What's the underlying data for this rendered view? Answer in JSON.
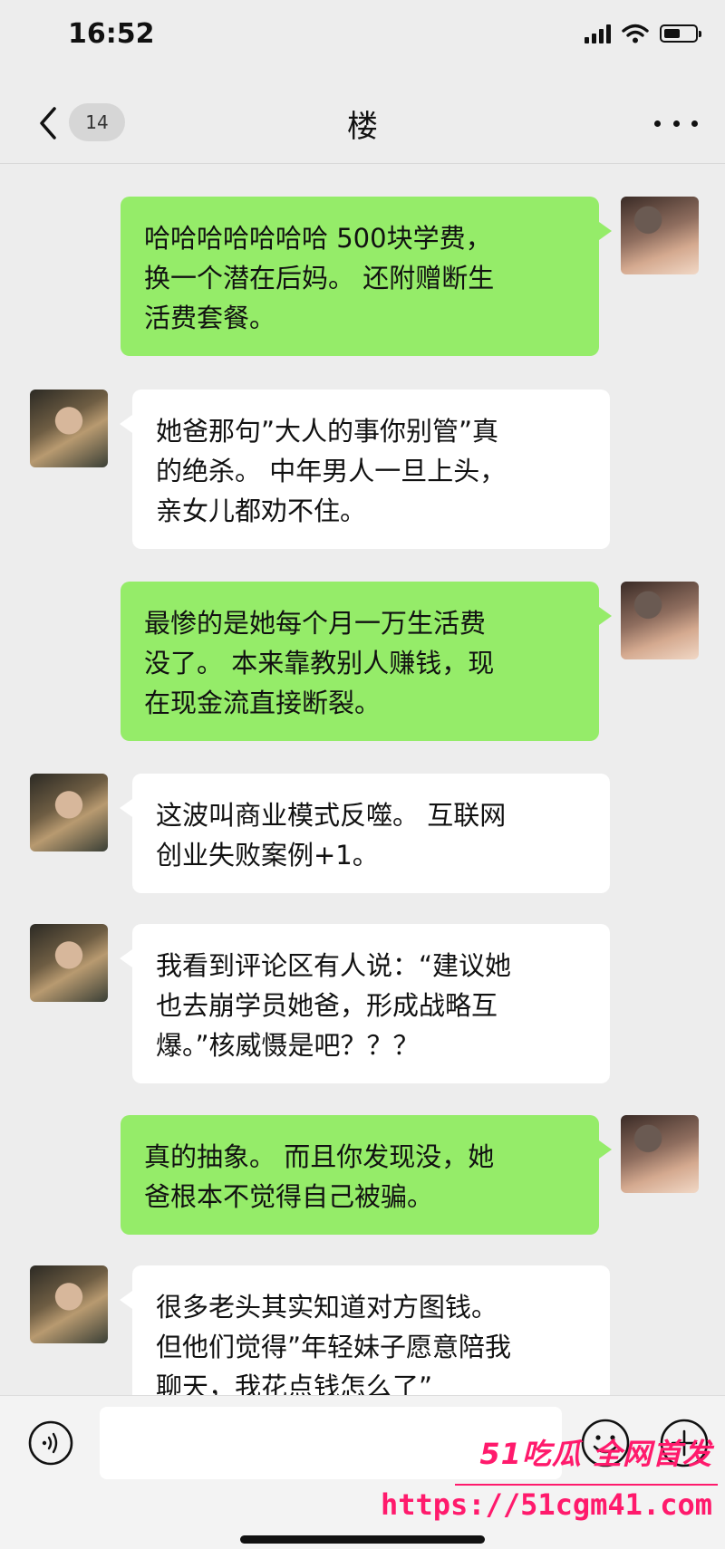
{
  "status_bar": {
    "time": "16:52"
  },
  "nav": {
    "badge": "14",
    "title": "楼"
  },
  "messages": [
    {
      "side": "me",
      "lines": [
        "哈哈哈哈哈哈哈 500块学费，",
        "换一个潜在后妈。 还附赠断生",
        "活费套餐。"
      ]
    },
    {
      "side": "them",
      "lines": [
        "她爸那句”大人的事你别管”真",
        "的绝杀。 中年男人一旦上头，",
        "亲女儿都劝不住。"
      ]
    },
    {
      "side": "me",
      "lines": [
        "最惨的是她每个月一万生活费",
        "没了。 本来靠教别人赚钱，现",
        "在现金流直接断裂。"
      ]
    },
    {
      "side": "them",
      "lines": [
        "这波叫商业模式反噬。 互联网",
        "创业失败案例+1。"
      ]
    },
    {
      "side": "them",
      "lines": [
        "我看到评论区有人说：“建议她",
        "也去崩学员她爸，形成战略互",
        "爆。”核威慑是吧？？？"
      ]
    },
    {
      "side": "me",
      "lines": [
        "真的抽象。 而且你发现没，她",
        "爸根本不觉得自己被骗。"
      ]
    },
    {
      "side": "them",
      "lines": [
        "很多老头其实知道对方图钱。",
        "但他们觉得”年轻妹子愿意陪我",
        "聊天，我花点钱怎么了”"
      ]
    }
  ],
  "watermark": {
    "brand": "51吃瓜 全网首发",
    "url": "https://51cgm41.com"
  }
}
